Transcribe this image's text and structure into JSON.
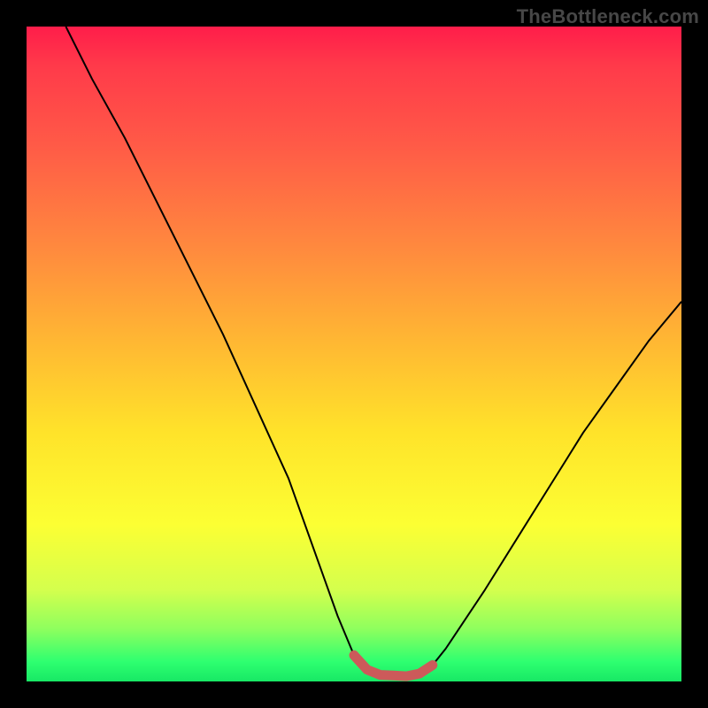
{
  "watermark": "TheBottleneck.com",
  "chart_data": {
    "type": "line",
    "title": "",
    "xlabel": "",
    "ylabel": "",
    "xlim": [
      0,
      100
    ],
    "ylim": [
      0,
      100
    ],
    "grid": false,
    "legend": false,
    "series": [
      {
        "name": "curve",
        "color": "#000000",
        "x": [
          6,
          10,
          15,
          20,
          25,
          30,
          35,
          40,
          45,
          47.5,
          50,
          52,
          55,
          58,
          60,
          62,
          64,
          70,
          75,
          80,
          85,
          90,
          95,
          100
        ],
        "y": [
          100,
          92,
          83,
          73,
          63,
          53,
          42,
          31,
          17,
          10,
          4,
          1.8,
          0.8,
          0.8,
          1.2,
          2.5,
          5,
          14,
          22,
          30,
          38,
          45,
          52,
          58
        ]
      },
      {
        "name": "optimal-range-marker",
        "color": "#cc5a5a",
        "x": [
          50,
          52,
          54,
          56,
          58,
          60,
          62
        ],
        "y": [
          4,
          1.8,
          1.0,
          0.9,
          0.8,
          1.2,
          2.5
        ]
      }
    ],
    "gradient_stops": [
      {
        "pos": 0,
        "color": "#ff1d4a"
      },
      {
        "pos": 6,
        "color": "#ff3a4a"
      },
      {
        "pos": 18,
        "color": "#ff5a47"
      },
      {
        "pos": 34,
        "color": "#ff8a3e"
      },
      {
        "pos": 48,
        "color": "#ffb733"
      },
      {
        "pos": 62,
        "color": "#ffe32a"
      },
      {
        "pos": 76,
        "color": "#fcff33"
      },
      {
        "pos": 86,
        "color": "#d4ff4d"
      },
      {
        "pos": 92,
        "color": "#8eff5e"
      },
      {
        "pos": 97,
        "color": "#2eff70"
      },
      {
        "pos": 100,
        "color": "#18e865"
      }
    ]
  }
}
